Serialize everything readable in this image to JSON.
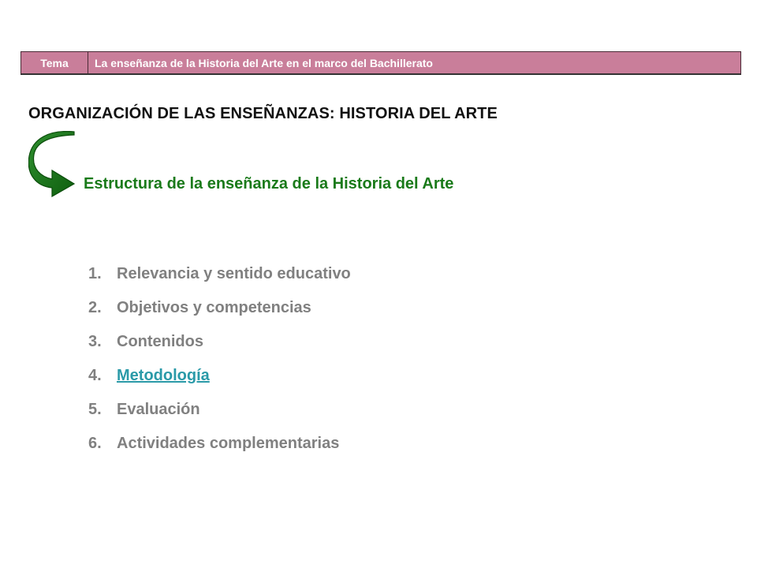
{
  "header": {
    "tag": "Tema",
    "title": "La enseñanza de la Historia del Arte en el marco del Bachillerato"
  },
  "section_title": "ORGANIZACIÓN DE LAS ENSEÑANZAS: HISTORIA DEL ARTE",
  "subsection_title": "Estructura de la enseñanza de la Historia del Arte",
  "icon": "curved-arrow-icon",
  "colors": {
    "header_bg": "#c97e9a",
    "subsection_green": "#1a7a1a",
    "link_teal": "#2a9aa8",
    "list_gray": "#808080"
  },
  "items": [
    {
      "number": "1.",
      "label": "Relevancia y sentido educativo",
      "active": false
    },
    {
      "number": "2.",
      "label": "Objetivos y competencias",
      "active": false
    },
    {
      "number": "3.",
      "label": "Contenidos",
      "active": false
    },
    {
      "number": "4.",
      "label": "Metodología",
      "active": true
    },
    {
      "number": "5.",
      "label": "Evaluación",
      "active": false
    },
    {
      "number": "6.",
      "label": "Actividades complementarias",
      "active": false
    }
  ]
}
